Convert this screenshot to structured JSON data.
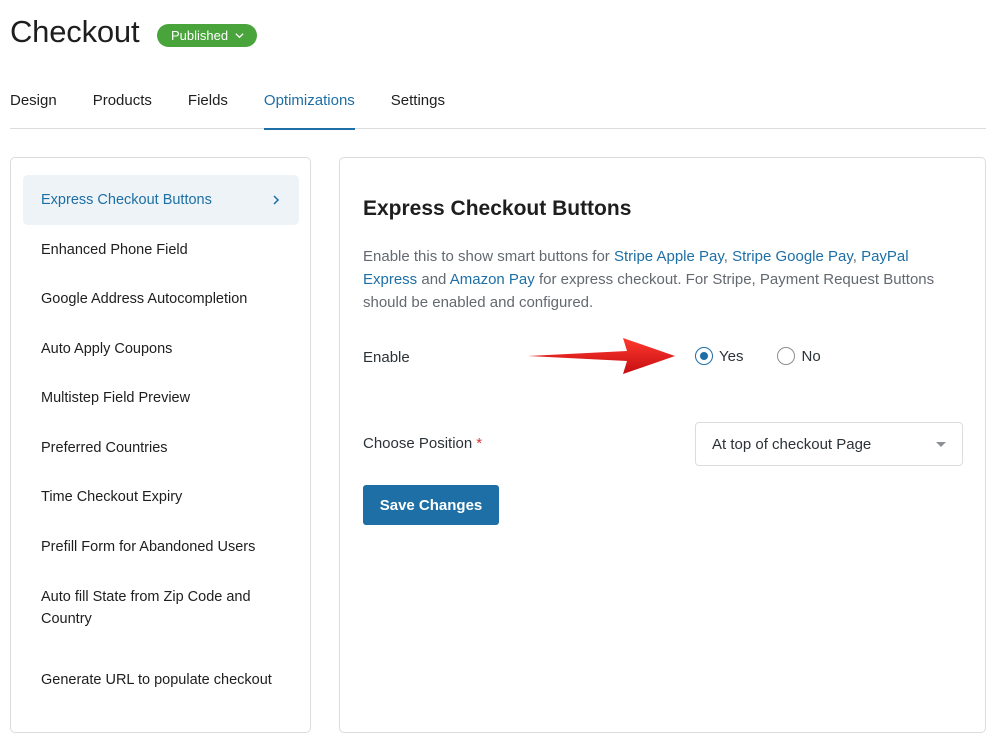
{
  "header": {
    "title": "Checkout",
    "status": "Published"
  },
  "tabs": [
    {
      "label": "Design"
    },
    {
      "label": "Products"
    },
    {
      "label": "Fields"
    },
    {
      "label": "Optimizations",
      "active": true
    },
    {
      "label": "Settings"
    }
  ],
  "sidebar": {
    "items": [
      {
        "label": "Express Checkout Buttons",
        "active": true
      },
      {
        "label": "Enhanced Phone Field"
      },
      {
        "label": "Google Address Autocompletion"
      },
      {
        "label": "Auto Apply Coupons"
      },
      {
        "label": "Multistep Field Preview"
      },
      {
        "label": "Preferred Countries"
      },
      {
        "label": "Time Checkout Expiry"
      },
      {
        "label": "Prefill Form for Abandoned Users"
      },
      {
        "label": "Auto fill State from Zip Code and Country"
      },
      {
        "label": "Generate URL to populate checkout"
      }
    ]
  },
  "panel": {
    "title": "Express Checkout Buttons",
    "desc": {
      "part1": "Enable this to show smart buttons for ",
      "link1": "Stripe Apple Pay",
      "sep1": ", ",
      "link2": "Stripe Google Pay",
      "sep2": ", ",
      "link3": "PayPal Express",
      "part2": " and ",
      "link4": "Amazon Pay",
      "part3": " for express checkout. For Stripe, Payment Request Buttons should be enabled and configured."
    },
    "enable": {
      "label": "Enable",
      "yes": "Yes",
      "no": "No",
      "selected": "Yes"
    },
    "position": {
      "label": "Choose Position",
      "required_mark": "*",
      "value": "At top of checkout Page"
    },
    "save_label": "Save Changes"
  },
  "colors": {
    "accent": "#1d6fa5",
    "badge": "#4aa43c",
    "arrow": "#e8141b",
    "required": "#d63638"
  }
}
